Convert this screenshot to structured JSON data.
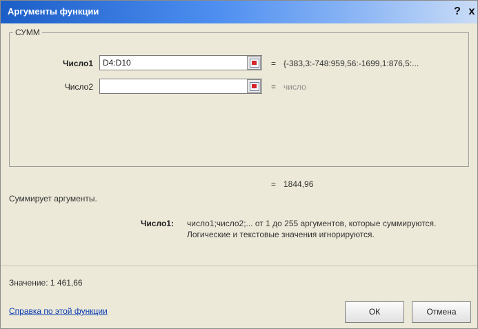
{
  "window": {
    "title": "Аргументы функции",
    "help_button": "?",
    "close_button": "x"
  },
  "group": {
    "title": "СУММ"
  },
  "args": [
    {
      "label": "Число1",
      "value": "D4:D10",
      "result": "{-383,3:-748:959,56:-1699,1:876,5:..."
    },
    {
      "label": "Число2",
      "value": "",
      "result": "число"
    }
  ],
  "equals_sign": "=",
  "formula_result": "1844,96",
  "description": "Суммирует аргументы.",
  "arg_help": {
    "name": "Число1:",
    "line1": "число1;число2;... от 1 до 255 аргументов, которые суммируются.",
    "line2": "Логические и текстовые значения игнорируются."
  },
  "value_line": "Значение:  1 461,66",
  "help_link": "Справка по этой функции",
  "buttons": {
    "ok": "ОК",
    "cancel": "Отмена"
  },
  "icons": {
    "ref_button": "collapse-dialog-icon"
  }
}
